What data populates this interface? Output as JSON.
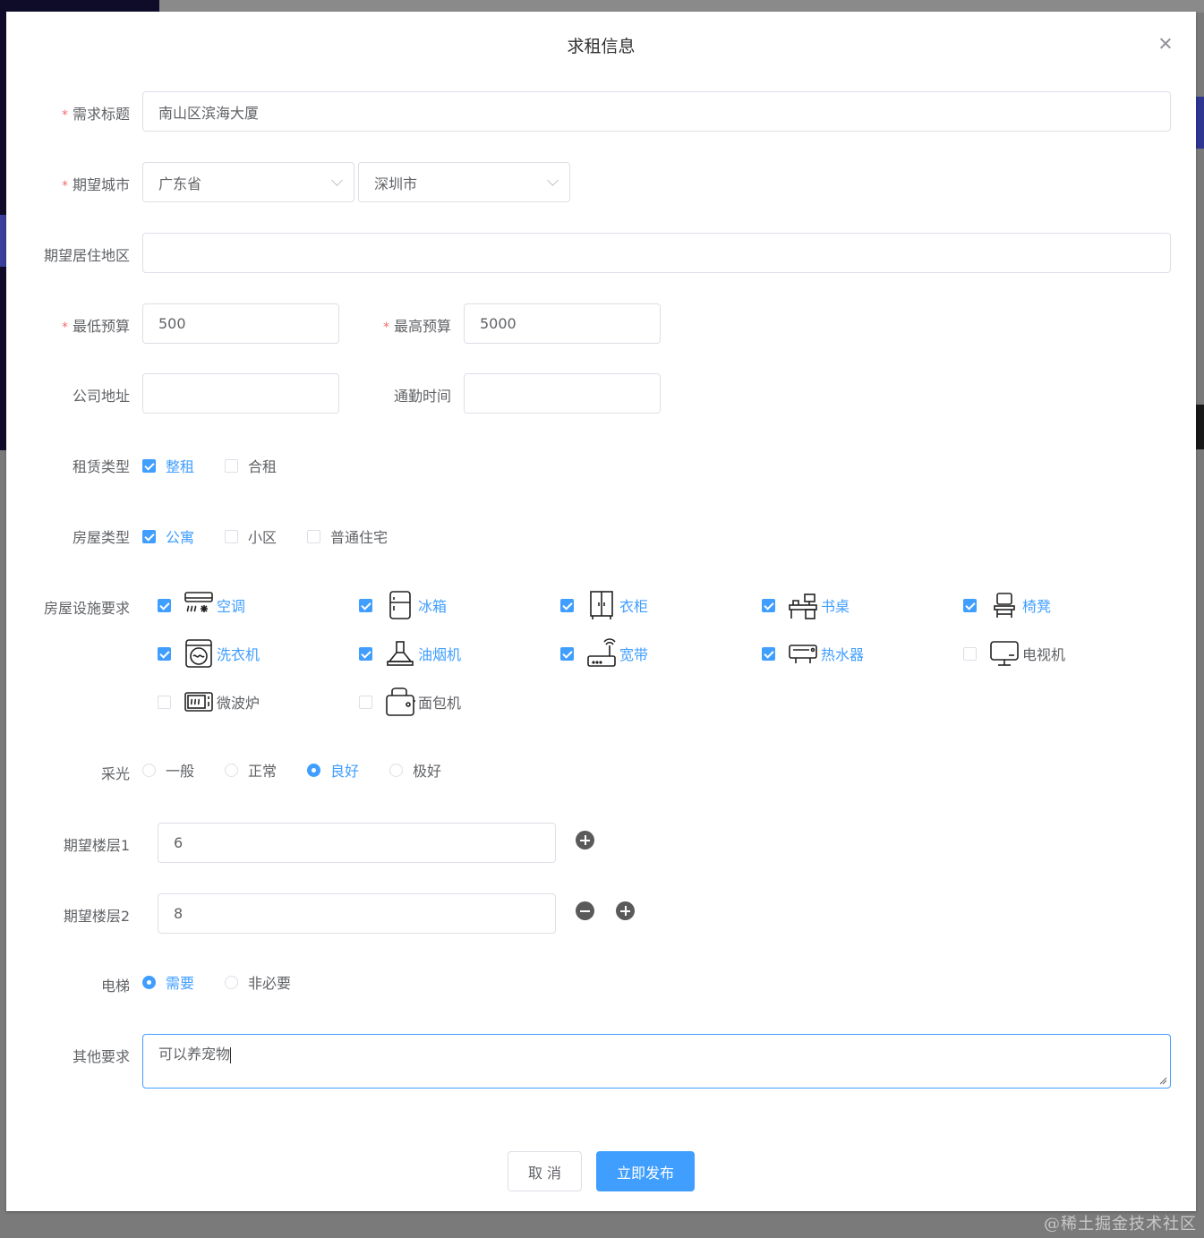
{
  "watermark": "@稀土掘金技术社区",
  "dialog": {
    "title": "求租信息",
    "fields": {
      "title_label": "需求标题",
      "title_value": "南山区滨海大厦",
      "city_label": "期望城市",
      "province": "广东省",
      "city": "深圳市",
      "area_label": "期望居住地区",
      "area_value": "",
      "min_budget_label": "最低预算",
      "min_budget": "500",
      "max_budget_label": "最高预算",
      "max_budget": "5000",
      "company_label": "公司地址",
      "company_value": "",
      "commute_label": "通勤时间",
      "commute_value": "",
      "rent_type_label": "租赁类型",
      "rent_types": [
        {
          "label": "整租",
          "checked": true
        },
        {
          "label": "合租",
          "checked": false
        }
      ],
      "house_type_label": "房屋类型",
      "house_types": [
        {
          "label": "公寓",
          "checked": true
        },
        {
          "label": "小区",
          "checked": false
        },
        {
          "label": "普通住宅",
          "checked": false
        }
      ],
      "facilities_label": "房屋设施要求",
      "facilities": [
        {
          "label": "空调",
          "icon": "air-conditioner-icon",
          "checked": true
        },
        {
          "label": "冰箱",
          "icon": "fridge-icon",
          "checked": true
        },
        {
          "label": "衣柜",
          "icon": "wardrobe-icon",
          "checked": true
        },
        {
          "label": "书桌",
          "icon": "desk-icon",
          "checked": true
        },
        {
          "label": "椅凳",
          "icon": "chair-icon",
          "checked": true
        },
        {
          "label": "洗衣机",
          "icon": "washing-machine-icon",
          "checked": true
        },
        {
          "label": "油烟机",
          "icon": "range-hood-icon",
          "checked": true
        },
        {
          "label": "宽带",
          "icon": "router-icon",
          "checked": true
        },
        {
          "label": "热水器",
          "icon": "water-heater-icon",
          "checked": true
        },
        {
          "label": "电视机",
          "icon": "tv-icon",
          "checked": false
        },
        {
          "label": "微波炉",
          "icon": "microwave-icon",
          "checked": false
        },
        {
          "label": "面包机",
          "icon": "toaster-icon",
          "checked": false
        }
      ],
      "light_label": "采光",
      "light_options": [
        {
          "label": "一般",
          "checked": false
        },
        {
          "label": "正常",
          "checked": false
        },
        {
          "label": "良好",
          "checked": true
        },
        {
          "label": "极好",
          "checked": false
        }
      ],
      "floor1_label": "期望楼层1",
      "floor1": "6",
      "floor2_label": "期望楼层2",
      "floor2": "8",
      "elevator_label": "电梯",
      "elevator_options": [
        {
          "label": "需要",
          "checked": true
        },
        {
          "label": "非必要",
          "checked": false
        }
      ],
      "other_label": "其他要求",
      "other_value": "可以养宠物"
    },
    "buttons": {
      "cancel": "取 消",
      "submit": "立即发布"
    },
    "colors": {
      "primary": "#409eff",
      "required": "#f56c6c",
      "text": "#606266"
    }
  }
}
